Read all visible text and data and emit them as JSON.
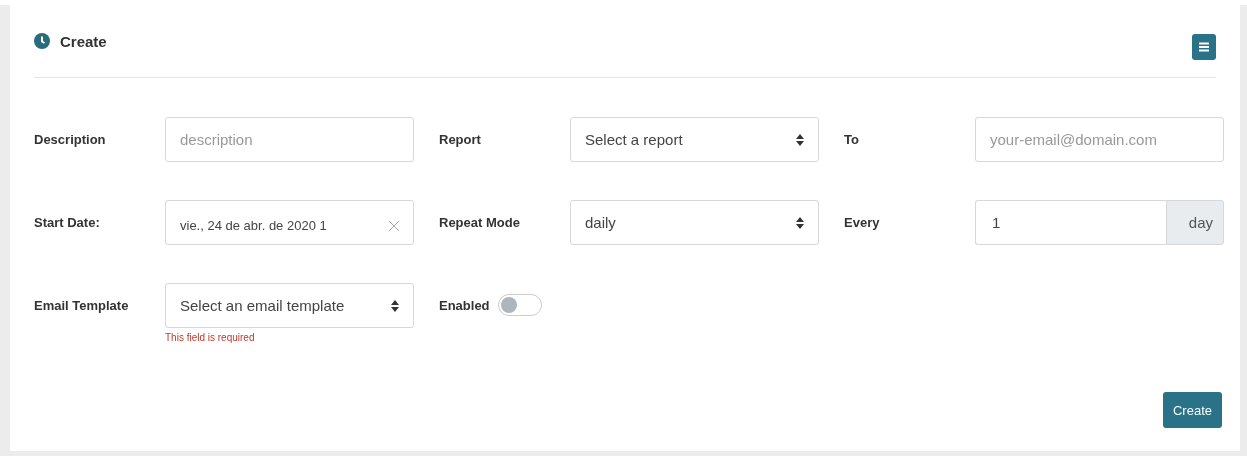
{
  "header": {
    "title": "Create"
  },
  "rows": [
    [
      {
        "kind": "text",
        "label": "Description",
        "placeholder": "description"
      },
      {
        "kind": "select",
        "label": "Report",
        "value": "Select a report"
      },
      {
        "kind": "text",
        "label": "To",
        "placeholder": "your-email@domain.com"
      }
    ],
    [
      {
        "kind": "date",
        "label": "Start Date:",
        "value": "vie., 24 de abr. de 2020 1"
      },
      {
        "kind": "select",
        "label": "Repeat Mode",
        "value": "daily"
      },
      {
        "kind": "addon",
        "label": "Every",
        "value": "1",
        "addon": "day"
      }
    ],
    [
      {
        "kind": "select",
        "label": "Email Template",
        "value": "Select an email template",
        "error": "This field is required"
      },
      {
        "kind": "toggle",
        "label": "Enabled",
        "on": false
      }
    ]
  ],
  "submit": "Create"
}
